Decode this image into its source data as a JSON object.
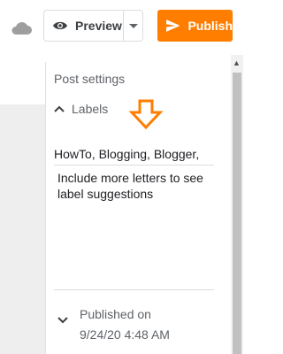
{
  "toolbar": {
    "preview_label": "Preview",
    "publish_label": "Publish",
    "icons": [
      "cloud-icon",
      "eye-icon",
      "caret-down-icon",
      "send-icon"
    ]
  },
  "settings": {
    "title": "Post settings",
    "labels": {
      "header": "Labels",
      "value": "HowTo, Blogging, Blogger,",
      "helper": "Include more letters to see label suggestions"
    },
    "published": {
      "label": "Published on",
      "date": "9/24/20 4:48 AM"
    }
  },
  "colors": {
    "publish_button": "#ff7e00",
    "annotation_arrow": "#ff7e00",
    "cloud_icon": "#9e9e9e"
  }
}
